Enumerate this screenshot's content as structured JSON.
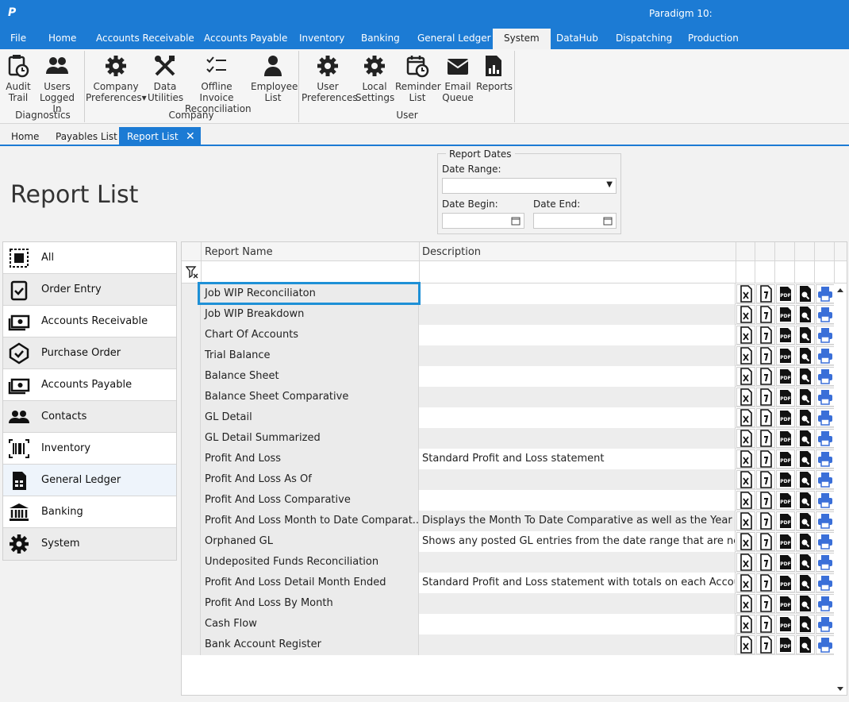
{
  "app": {
    "logo": "P",
    "title": "Paradigm 10:"
  },
  "menu": [
    "File",
    "Home",
    "Accounts Receivable",
    "Accounts Payable",
    "Inventory",
    "Banking",
    "General Ledger",
    "System",
    "DataHub",
    "Dispatching",
    "Production"
  ],
  "ribbon": {
    "buttons": [
      {
        "label1": "Audit",
        "label2": "Trail",
        "icon": "clock-document-icon"
      },
      {
        "label1": "Users",
        "label2": "Logged In",
        "icon": "users-icon"
      },
      {
        "label1": "Company",
        "label2": "Preferences",
        "icon": "gear-icon"
      },
      {
        "label1": "Data",
        "label2": "Utilities",
        "icon": "tools-icon"
      },
      {
        "label1": "Offline Invoice",
        "label2": "Reconciliation",
        "icon": "checklist-icon"
      },
      {
        "label1": "Employee",
        "label2": "List",
        "icon": "person-icon"
      },
      {
        "label1": "User",
        "label2": "Preferences",
        "icon": "gear-icon"
      },
      {
        "label1": "Local",
        "label2": "Settings",
        "icon": "gear-icon"
      },
      {
        "label1": "Reminder",
        "label2": "List",
        "icon": "calendar-clock-icon"
      },
      {
        "label1": "Email",
        "label2": "Queue",
        "icon": "mail-icon"
      },
      {
        "label1": "Reports",
        "label2": "",
        "icon": "report-icon"
      }
    ],
    "groups": [
      "Diagnostics",
      "Company",
      "User"
    ]
  },
  "doc_tabs": [
    "Home",
    "Payables List",
    "Report List"
  ],
  "page_title": "Report List",
  "report_dates": {
    "legend": "Report Dates",
    "date_range_label": "Date Range:",
    "date_begin_label": "Date Begin:",
    "date_end_label": "Date End:",
    "date_range_value": "",
    "date_begin_value": "",
    "date_end_value": ""
  },
  "sidebar": [
    {
      "label": "All",
      "icon": "all-icon"
    },
    {
      "label": "Order Entry",
      "icon": "clipboard-check-icon"
    },
    {
      "label": "Accounts Receivable",
      "icon": "money-icon"
    },
    {
      "label": "Purchase Order",
      "icon": "check-badge-icon"
    },
    {
      "label": "Accounts Payable",
      "icon": "money-icon"
    },
    {
      "label": "Contacts",
      "icon": "contacts-icon"
    },
    {
      "label": "Inventory",
      "icon": "barcode-icon"
    },
    {
      "label": "General Ledger",
      "icon": "ledger-icon"
    },
    {
      "label": "Banking",
      "icon": "bank-icon"
    },
    {
      "label": "System",
      "icon": "gear-icon"
    }
  ],
  "grid": {
    "columns": [
      "Report Name",
      "Description"
    ],
    "action_icons": [
      "excel-icon",
      "word-icon",
      "pdf-icon",
      "preview-icon",
      "print-icon"
    ],
    "rows": [
      {
        "name": "Job WIP Reconciliaton",
        "description": ""
      },
      {
        "name": "Job WIP Breakdown",
        "description": ""
      },
      {
        "name": "Chart Of Accounts",
        "description": ""
      },
      {
        "name": "Trial Balance",
        "description": ""
      },
      {
        "name": "Balance Sheet",
        "description": ""
      },
      {
        "name": "Balance Sheet Comparative",
        "description": ""
      },
      {
        "name": "GL Detail",
        "description": ""
      },
      {
        "name": "GL Detail Summarized",
        "description": ""
      },
      {
        "name": "Profit And Loss",
        "description": "Standard Profit and Loss statement"
      },
      {
        "name": "Profit And Loss As Of",
        "description": ""
      },
      {
        "name": "Profit And Loss Comparative",
        "description": ""
      },
      {
        "name": "Profit And Loss Month to Date Comparat...",
        "description": "Displays the Month To Date Comparative as well as the Year t..."
      },
      {
        "name": "Orphaned GL",
        "description": "Shows any posted GL entries from the date range that are no..."
      },
      {
        "name": "Undeposited Funds Reconciliation",
        "description": ""
      },
      {
        "name": "Profit And Loss Detail Month Ended",
        "description": "Standard Profit and Loss statement with totals on each Accou..."
      },
      {
        "name": "Profit And Loss By Month",
        "description": ""
      },
      {
        "name": "Cash Flow",
        "description": ""
      },
      {
        "name": "Bank Account Register",
        "description": ""
      }
    ]
  },
  "colors": {
    "accent": "#1c7bd4",
    "focus": "#1e90d6",
    "print": "#3a6fd8"
  }
}
